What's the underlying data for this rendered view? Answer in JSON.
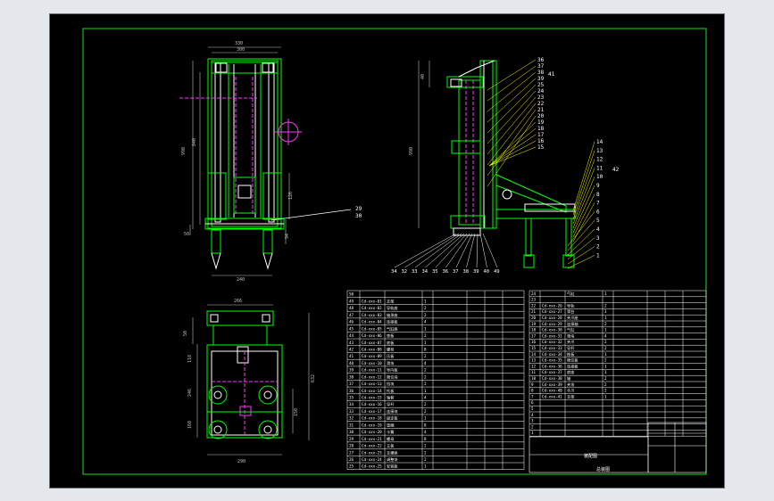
{
  "colors": {
    "app_bg": "#e4e7ec",
    "sheet_bg": "#000000",
    "frame": "#19e219",
    "part": "#00ff00",
    "line": "#ffffff",
    "hidden": "#ff33ff",
    "leader": "#ffff00",
    "dimension": "#c0c0c0",
    "table_line": "#ffffff"
  },
  "front_view": {
    "dims": {
      "top_outer": "330",
      "top_inner": "300",
      "height": "990",
      "height_inner": "840",
      "sub1": "126",
      "sub2": "94",
      "bottom": "292",
      "foot": "240",
      "left_small": "50"
    },
    "callouts": [
      "29",
      "30"
    ]
  },
  "side_view": {
    "dims": {
      "height": "990",
      "top": "40"
    },
    "callouts_right": [
      "36",
      "37",
      "38",
      "39",
      "25",
      "24",
      "23",
      "22",
      "21",
      "20",
      "19",
      "18",
      "17",
      "16",
      "15",
      "14",
      "13",
      "12",
      "11",
      "10",
      "9",
      "8",
      "7",
      "6",
      "5",
      "4",
      "3",
      "2",
      "1"
    ],
    "callouts_bottom": [
      "34",
      "32",
      "33",
      "34",
      "35",
      "36",
      "37",
      "38",
      "39",
      "40",
      "49"
    ],
    "callout_extra": [
      "41",
      "42"
    ]
  },
  "top_view": {
    "dims": {
      "width": "266",
      "height": "632",
      "left1": "50",
      "left2": "118",
      "left3": "246",
      "left4": "160",
      "right_in": "150",
      "bottom": "290"
    }
  },
  "bom": {
    "left": {
      "numbers": [
        "50",
        "49",
        "48",
        "47",
        "46",
        "45",
        "44",
        "43",
        "42",
        "41",
        "40",
        "39",
        "38",
        "37",
        "36",
        "35",
        "34",
        "33",
        "32",
        "31",
        "30",
        "29",
        "28",
        "27",
        "26",
        "25"
      ],
      "codes": [
        "",
        "Cd-xxx-01",
        "Cd-xxx-02",
        "Cd-xxx-03",
        "Cd-xxx-04",
        "Cd-xxx-05",
        "Cd-xxx-06",
        "Cd-xxx-07",
        "Cd-xxx-08",
        "Cd-xxx-09",
        "Cd-xxx-10",
        "Cd-xxx-11",
        "Cd-xxx-12",
        "Cd-xxx-13",
        "Cd-xxx-14",
        "Cd-xxx-15",
        "Cd-xxx-16",
        "Cd-xxx-17",
        "Cd-xxx-18",
        "Cd-xxx-19",
        "Cd-xxx-20",
        "Cd-xxx-21",
        "Cd-xxx-22",
        "Cd-xxx-23",
        "Cd-xxx-24",
        "Cd-xxx-25"
      ],
      "names": [
        "",
        "支架",
        "导轨座",
        "轴承座",
        "连接板",
        "气缸座",
        "垫板",
        "底板",
        "螺栓",
        "压板",
        "滑块",
        "导向板",
        "限位块",
        "挡块",
        "托板",
        "轴套",
        "导杆",
        "连接块",
        "固定板",
        "垫圈",
        "卡簧",
        "螺母",
        "立板",
        "支撑座",
        "调整块",
        "安装板"
      ],
      "qty": [
        "",
        "1",
        "2",
        "2",
        "4",
        "1",
        "2",
        "1",
        "8",
        "2",
        "4",
        "2",
        "2",
        "2",
        "1",
        "4",
        "2",
        "2",
        "1",
        "8",
        "4",
        "8",
        "2",
        "2",
        "2",
        "1"
      ]
    },
    "right": {
      "numbers": [
        "24",
        "23",
        "22",
        "21",
        "20",
        "19",
        "18",
        "17",
        "16",
        "15",
        "14",
        "13",
        "12",
        "11",
        "10",
        "9",
        "8",
        "7",
        "6",
        "5",
        "4",
        "3",
        "2",
        "1"
      ],
      "codes": [
        "",
        "",
        "Cd-xxx-26",
        "Cd-xxx-27",
        "Cd-xxx-28",
        "Cd-xxx-29",
        "Cd-xxx-30",
        "Cd-xxx-31",
        "Cd-xxx-32",
        "Cd-xxx-33",
        "Cd-xxx-34",
        "Cd-xxx-35",
        "Cd-xxx-36",
        "Cd-xxx-37",
        "Cd-xxx-38",
        "Cd-xxx-39",
        "Cd-xxx-40",
        "Cd-xxx-41",
        "",
        "",
        "",
        "",
        "",
        ""
      ],
      "names": [
        "气缸",
        "",
        "导轨",
        "滑台",
        "夹爪座",
        "连接轴",
        "气缸",
        "滑块",
        "夹爪",
        "导杆",
        "推板",
        "限位板",
        "连接板",
        "底座",
        "轴",
        "夹块",
        "手爪",
        "支架",
        "",
        "",
        "",
        "",
        "",
        ""
      ],
      "qty": [
        "1",
        "",
        "2",
        "1",
        "1",
        "2",
        "1",
        "4",
        "2",
        "2",
        "1",
        "2",
        "1",
        "1",
        "2",
        "2",
        "2",
        "1",
        "",
        "",
        "",
        "",
        "",
        ""
      ]
    },
    "title_block": {
      "drawing_title": "装配图",
      "drawing_no": "总装图"
    }
  }
}
